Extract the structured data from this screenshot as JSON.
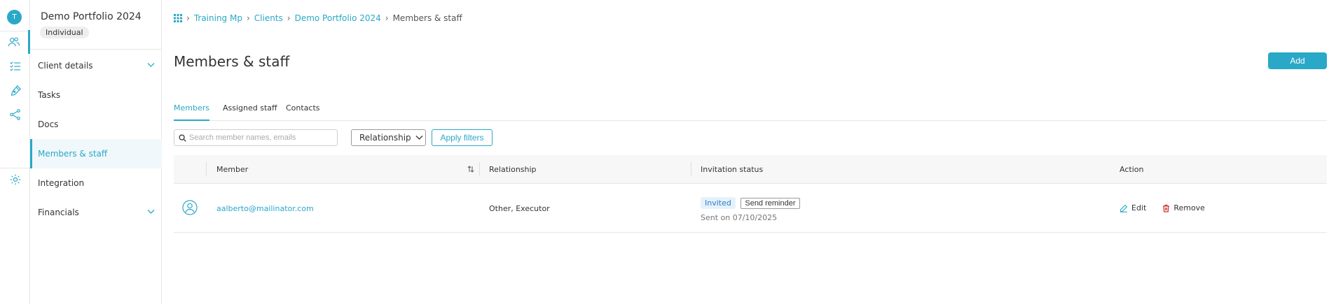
{
  "rail": {
    "avatar_letter": "T",
    "icons": [
      "users-icon",
      "checklist-icon",
      "pen-icon",
      "share-icon",
      "gear-icon"
    ]
  },
  "side": {
    "title": "Demo Portfolio 2024",
    "badge": "Individual",
    "items": [
      {
        "label": "Client details",
        "has_chevron": true
      },
      {
        "label": "Tasks"
      },
      {
        "label": "Docs"
      },
      {
        "label": "Members & staff",
        "active": true
      },
      {
        "label": "Integration"
      },
      {
        "label": "Financials",
        "has_chevron": true
      }
    ]
  },
  "breadcrumb": {
    "items": [
      "Training Mp",
      "Clients",
      "Demo Portfolio 2024"
    ],
    "current": "Members & staff"
  },
  "page": {
    "title": "Members & staff",
    "add_label": "Add"
  },
  "tabs": [
    "Members",
    "Assigned staff",
    "Contacts"
  ],
  "filters": {
    "search_placeholder": "Search member names, emails",
    "relationship_label": "Relationship",
    "apply_label": "Apply filters"
  },
  "table": {
    "headers": {
      "member": "Member",
      "relationship": "Relationship",
      "invitation": "Invitation status",
      "action": "Action"
    },
    "rows": [
      {
        "email": "aalberto@mailinator.com",
        "relationship": "Other, Executor",
        "status": "Invited",
        "reminder_label": "Send reminder",
        "sent": "Sent on 07/10/2025",
        "edit_label": "Edit",
        "remove_label": "Remove"
      }
    ]
  },
  "colors": {
    "accent": "#2aa8c7",
    "remove": "#d0312d"
  }
}
